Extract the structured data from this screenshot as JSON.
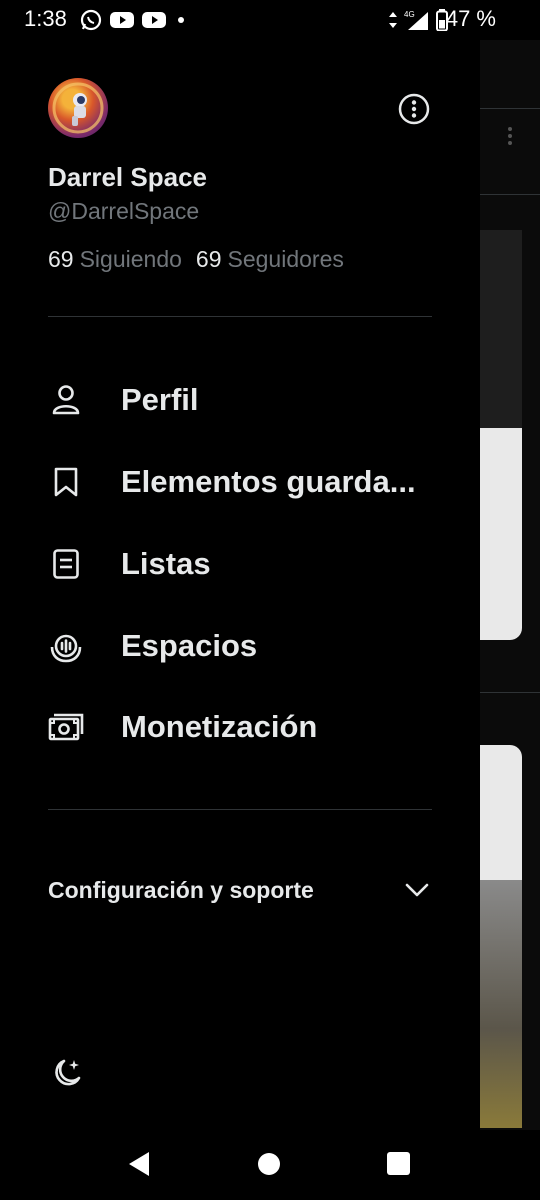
{
  "status_bar": {
    "time": "1:38",
    "left_icons": [
      "whatsapp-icon",
      "youtube-icon",
      "youtube-icon",
      "dot-icon"
    ],
    "network": "4G",
    "battery": "47 %"
  },
  "profile": {
    "name": "Darrel Space",
    "handle": "@DarrelSpace",
    "following_count": "69",
    "following_label": "Siguiendo",
    "followers_count": "69",
    "followers_label": "Seguidores"
  },
  "menu": {
    "items": [
      {
        "label": "Perfil",
        "icon": "person-icon"
      },
      {
        "label": "Elementos guarda...",
        "icon": "bookmark-icon"
      },
      {
        "label": "Listas",
        "icon": "list-icon"
      },
      {
        "label": "Espacios",
        "icon": "spaces-icon"
      },
      {
        "label": "Monetización",
        "icon": "money-icon"
      }
    ]
  },
  "settings": {
    "label": "Configuración y soporte"
  },
  "colors": {
    "background": "#000000",
    "text": "#e7e9ea",
    "secondary_text": "#71767b",
    "divider": "#2f3336"
  }
}
